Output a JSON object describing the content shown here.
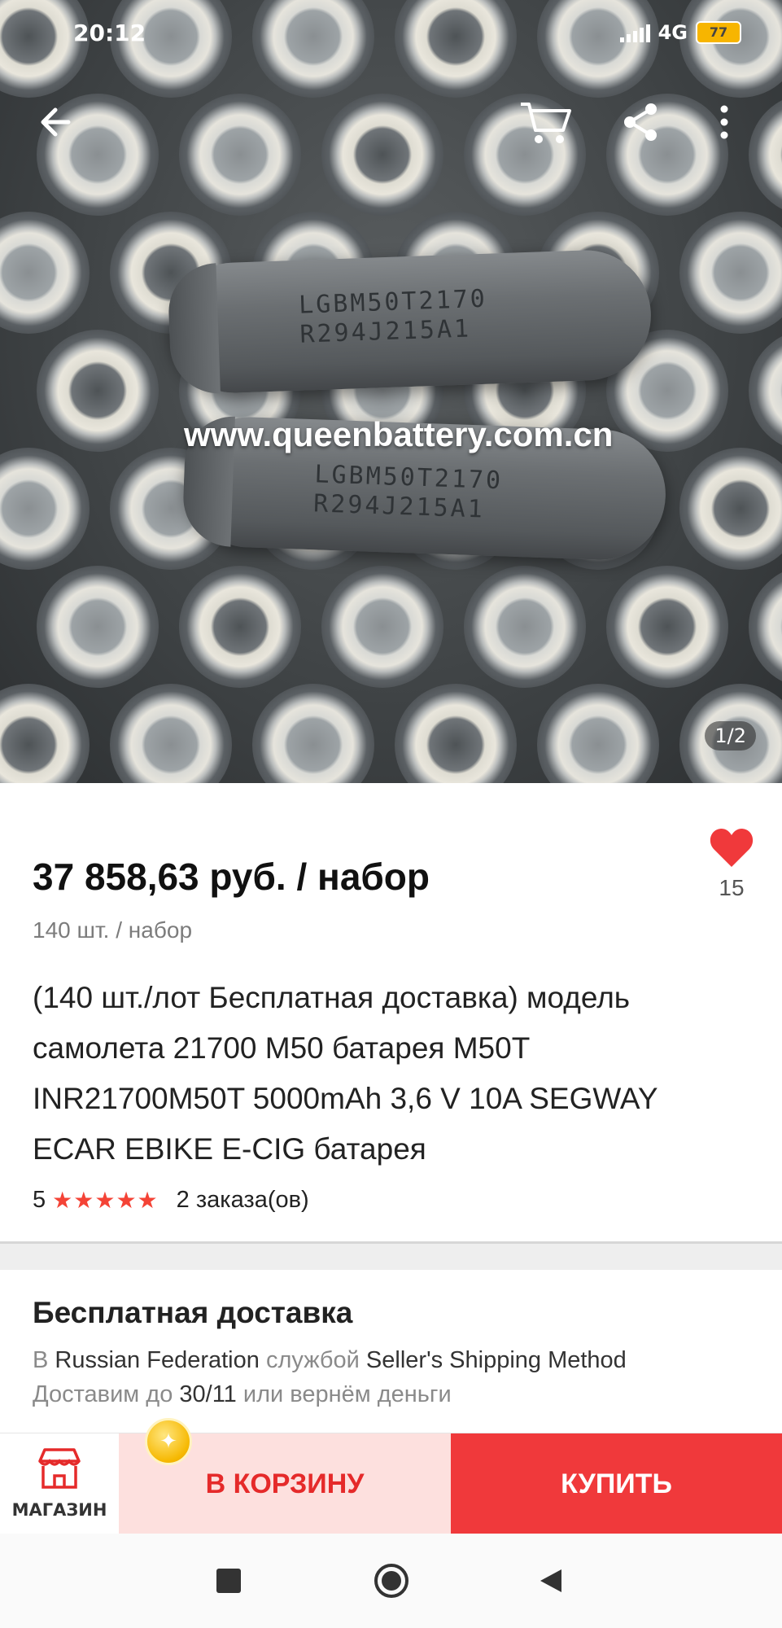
{
  "status_bar": {
    "time": "20:12",
    "network": "4G",
    "battery": "77"
  },
  "gallery": {
    "counter": "1/2",
    "watermark": "www.queenbattery.com.cn",
    "battery_print_line1": "LGBM50T2170",
    "battery_print_line2": "R294J215A1"
  },
  "product": {
    "price": "37 858,63 руб. / набор",
    "unit": "140 шт. / набор",
    "favorites": "15",
    "title": "(140 шт./лот Бесплатная доставка) модель самолета 21700 M50 батарея M50T INR21700M50T 5000mAh 3,6 V 10A SEGWAY ECAR EBIKE E-CIG батарея",
    "rating": "5",
    "stars": "★★★★★",
    "orders": "2 заказа(ов)"
  },
  "shipping": {
    "title": "Бесплатная доставка",
    "line1_prefix": "В ",
    "country": "Russian Federation",
    "line1_mid": " службой ",
    "method": "Seller's Shipping Method",
    "line2_prefix": "Доставим до ",
    "date": "30/11",
    "line2_suffix": " или вернём деньги"
  },
  "actions": {
    "store": "МАГАЗИН",
    "add_to_cart": "В КОРЗИНУ",
    "buy": "КУПИТЬ"
  },
  "colors": {
    "accent": "#f0393b",
    "cart_bg": "#fde0de",
    "star": "#f44336"
  },
  "icons": [
    "back-arrow-icon",
    "cart-icon",
    "share-icon",
    "more-icon",
    "heart-icon",
    "store-icon",
    "coin-icon",
    "nav-square-icon",
    "nav-circle-icon",
    "nav-back-icon"
  ]
}
